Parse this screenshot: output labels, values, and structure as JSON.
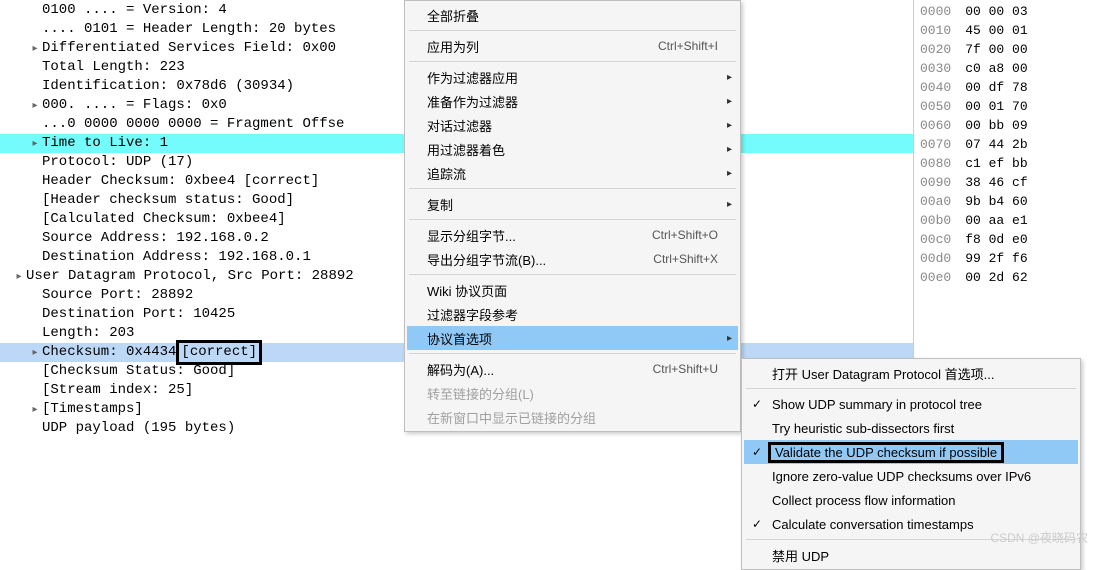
{
  "tree": [
    {
      "idt": 1,
      "exp": false,
      "text": "0100 .... = Version: 4"
    },
    {
      "idt": 1,
      "exp": false,
      "text": ".... 0101 = Header Length: 20 bytes"
    },
    {
      "idt": 1,
      "exp": true,
      "text": "Differentiated Services Field: 0x00"
    },
    {
      "idt": 1,
      "exp": false,
      "text": "Total Length: 223"
    },
    {
      "idt": 1,
      "exp": false,
      "text": "Identification: 0x78d6 (30934)"
    },
    {
      "idt": 1,
      "exp": true,
      "text": "000. .... = Flags: 0x0"
    },
    {
      "idt": 1,
      "exp": false,
      "text": "...0 0000 0000 0000 = Fragment Offse"
    },
    {
      "idt": 1,
      "exp": true,
      "text": "Time to Live: 1",
      "hl": "cyan"
    },
    {
      "idt": 1,
      "exp": false,
      "text": "Protocol: UDP (17)"
    },
    {
      "idt": 1,
      "exp": false,
      "text": "Header Checksum: 0xbee4 [correct]"
    },
    {
      "idt": 1,
      "exp": false,
      "text": "[Header checksum status: Good]"
    },
    {
      "idt": 1,
      "exp": false,
      "text": "[Calculated Checksum: 0xbee4]"
    },
    {
      "idt": 1,
      "exp": false,
      "text": "Source Address: 192.168.0.2"
    },
    {
      "idt": 1,
      "exp": false,
      "text": "Destination Address: 192.168.0.1"
    },
    {
      "idt": 0,
      "exp": true,
      "text": "User Datagram Protocol, Src Port: 28892"
    },
    {
      "idt": 1,
      "exp": false,
      "text": "Source Port: 28892"
    },
    {
      "idt": 1,
      "exp": false,
      "text": "Destination Port: 10425"
    },
    {
      "idt": 1,
      "exp": false,
      "text": "Length: 203"
    },
    {
      "idt": 1,
      "exp": true,
      "prefix": "Checksum: 0x4434 ",
      "boxed": "[correct]",
      "hl": "blue"
    },
    {
      "idt": 1,
      "exp": false,
      "text": "[Checksum Status: Good]"
    },
    {
      "idt": 1,
      "exp": false,
      "text": "[Stream index: 25]"
    },
    {
      "idt": 1,
      "exp": true,
      "text": "[Timestamps]"
    },
    {
      "idt": 1,
      "exp": false,
      "text": "UDP payload (195 bytes)"
    }
  ],
  "hex": [
    {
      "addr": "0000",
      "b": "00 00 03"
    },
    {
      "addr": "0010",
      "b": "45 00 01"
    },
    {
      "addr": "0020",
      "b": "7f 00 00"
    },
    {
      "addr": "0030",
      "b": "c0 a8 00"
    },
    {
      "addr": "0040",
      "b": "00 df 78"
    },
    {
      "addr": "0050",
      "b": "00 01 70"
    },
    {
      "addr": "0060",
      "b": "00 bb 09"
    },
    {
      "addr": "0070",
      "b": "07 44 2b"
    },
    {
      "addr": "0080",
      "b": "c1 ef bb"
    },
    {
      "addr": "0090",
      "b": "38 46 cf"
    },
    {
      "addr": "00a0",
      "b": "9b b4 60"
    },
    {
      "addr": "00b0",
      "b": "00 aa e1"
    },
    {
      "addr": "00c0",
      "b": "f8 0d e0"
    },
    {
      "addr": "00d0",
      "b": "99 2f f6"
    },
    {
      "addr": "00e0",
      "b": "00 2d 62"
    }
  ],
  "menu": {
    "collapse_all": "全部折叠",
    "apply_as_column": "应用为列",
    "apply_as_column_sc": "Ctrl+Shift+I",
    "apply_as_filter": "作为过滤器应用",
    "prepare_filter": "准备作为过滤器",
    "conv_filter": "对话过滤器",
    "colorize_filter": "用过滤器着色",
    "follow": "追踪流",
    "copy": "复制",
    "show_bytes": "显示分组字节...",
    "show_bytes_sc": "Ctrl+Shift+O",
    "export_bytes": "导出分组字节流(B)...",
    "export_bytes_sc": "Ctrl+Shift+X",
    "wiki": "Wiki 协议页面",
    "filter_ref": "过滤器字段参考",
    "proto_prefs": "协议首选项",
    "decode_as": "解码为(A)...",
    "decode_as_sc": "Ctrl+Shift+U",
    "goto_linked": "转至链接的分组(L)",
    "show_linked": "在新窗口中显示已链接的分组"
  },
  "submenu": {
    "open_prefs": "打开 User Datagram Protocol 首选项...",
    "show_summary": "Show UDP summary in protocol tree",
    "try_heuristic": "Try heuristic sub-dissectors first",
    "validate": "Validate the UDP checksum if possible",
    "ignore_zero": "Ignore zero-value UDP checksums over IPv6",
    "collect_flow": "Collect process flow information",
    "calc_conv": "Calculate conversation timestamps",
    "disable_udp": "禁用 UDP"
  },
  "watermark": "CSDN @夜晓码农"
}
